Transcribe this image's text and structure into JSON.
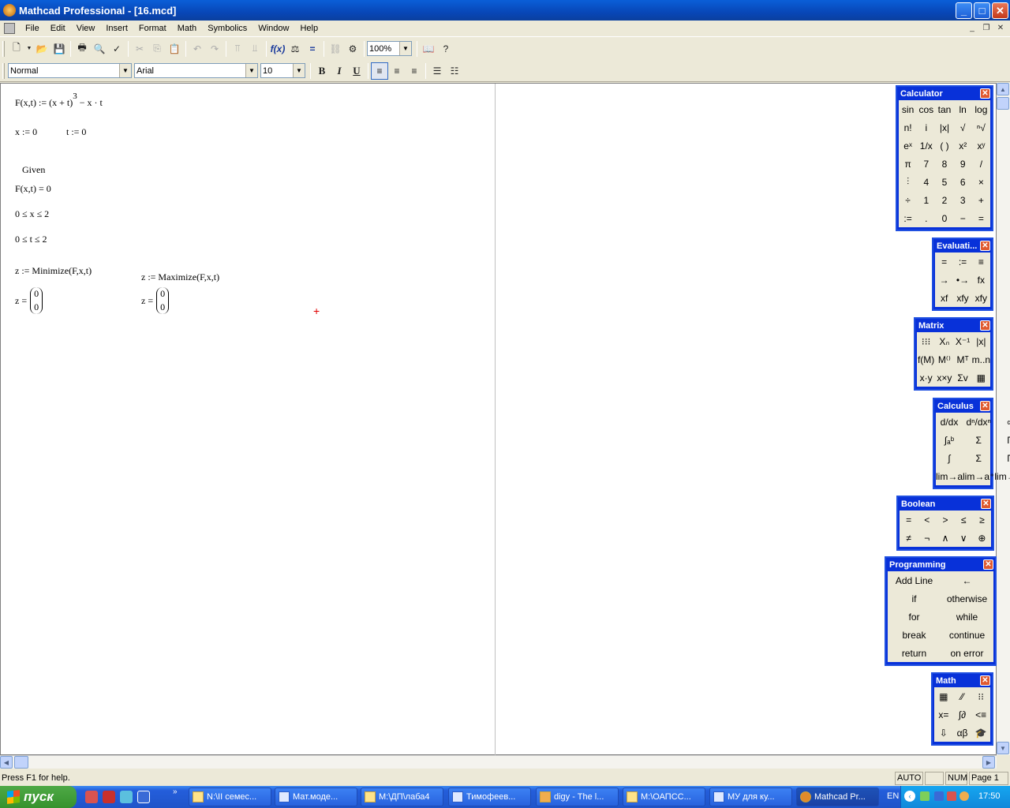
{
  "window": {
    "title": "Mathcad Professional - [16.mcd]",
    "min": "_",
    "max": "□",
    "close": "✕"
  },
  "menu": [
    "File",
    "Edit",
    "View",
    "Insert",
    "Format",
    "Math",
    "Symbolics",
    "Window",
    "Help"
  ],
  "mdi": {
    "min": "_",
    "restore": "❐",
    "close": "✕"
  },
  "toolbar": {
    "zoom": "100%"
  },
  "format_bar": {
    "style": "Normal",
    "font": "Arial",
    "size": "10",
    "bold": "B",
    "italic": "I",
    "underline": "U"
  },
  "worksheet": {
    "def_f": "F(x,t) := (x + t)",
    "def_f_exp": "3",
    "def_f_rest": "− x · t",
    "x_init": "x := 0",
    "t_init": "t := 0",
    "given": "Given",
    "constraint1": "F(x,t) = 0",
    "constraint2": "0 ≤ x ≤ 2",
    "constraint3": "0 ≤ t ≤ 2",
    "minimize": "z := Minimize(F,x,t)",
    "maximize": "z := Maximize(F,x,t)",
    "z_label": "z =",
    "z_min": [
      "0",
      "0"
    ],
    "z_max": [
      "0",
      "0"
    ],
    "cursor": "+"
  },
  "status": {
    "help": "Press F1 for help.",
    "mode": "AUTO",
    "num": "NUM",
    "page": "Page 1"
  },
  "taskbar": {
    "start": "пуск",
    "tasks": [
      "N:\\II семес...",
      "Мат.моде...",
      "M:\\ДП\\лаба4",
      "Тимофеев...",
      "digy - The l...",
      "M:\\ОАПСС...",
      "МУ для ку...",
      "Mathcad Pr..."
    ],
    "lang": "EN",
    "clock": "17:50"
  },
  "palettes": {
    "calculator": {
      "title": "Calculator",
      "buttons": [
        "sin",
        "cos",
        "tan",
        "ln",
        "log",
        "n!",
        "i",
        "|x|",
        "√",
        "ⁿ√",
        "eˣ",
        "1/x",
        "( )",
        "x²",
        "xʸ",
        "π",
        "7",
        "8",
        "9",
        "/",
        "⫶",
        "4",
        "5",
        "6",
        "×",
        "÷",
        "1",
        "2",
        "3",
        "+",
        ":=",
        ".",
        "0",
        "−",
        "="
      ]
    },
    "evaluation": {
      "title": "Evaluati...",
      "buttons": [
        "=",
        ":=",
        "≡",
        "→",
        "•→",
        "fx",
        "xf",
        "xfy",
        "xfy"
      ]
    },
    "matrix": {
      "title": "Matrix",
      "buttons": [
        "⁝⁝⁝",
        "Xₙ",
        "X⁻¹",
        "|x|",
        "f(M)",
        "M⁽⁾",
        "Mᵀ",
        "m..n",
        "x·y",
        "x×y",
        "Σv",
        "▦"
      ]
    },
    "calculus": {
      "title": "Calculus",
      "buttons": [
        "d/dx",
        "dⁿ/dxⁿ",
        "∞",
        "∫ₐᵇ",
        "Σ",
        "Π",
        "∫",
        "Σ",
        "Π",
        "lim→a",
        "lim→a⁺",
        "lim→a⁻"
      ]
    },
    "boolean": {
      "title": "Boolean",
      "buttons": [
        "=",
        "<",
        ">",
        "≤",
        "≥",
        "≠",
        "¬",
        "∧",
        "∨",
        "⊕"
      ]
    },
    "programming": {
      "title": "Programming",
      "buttons": [
        "Add Line",
        "←",
        "if",
        "otherwise",
        "for",
        "while",
        "break",
        "continue",
        "return",
        "on error"
      ]
    },
    "math": {
      "title": "Math",
      "buttons": [
        "▦",
        "⁄⁄",
        "⁝⁝",
        "x=",
        "∫∂",
        "<≡",
        "⇩",
        "αβ",
        "🎓"
      ]
    }
  }
}
